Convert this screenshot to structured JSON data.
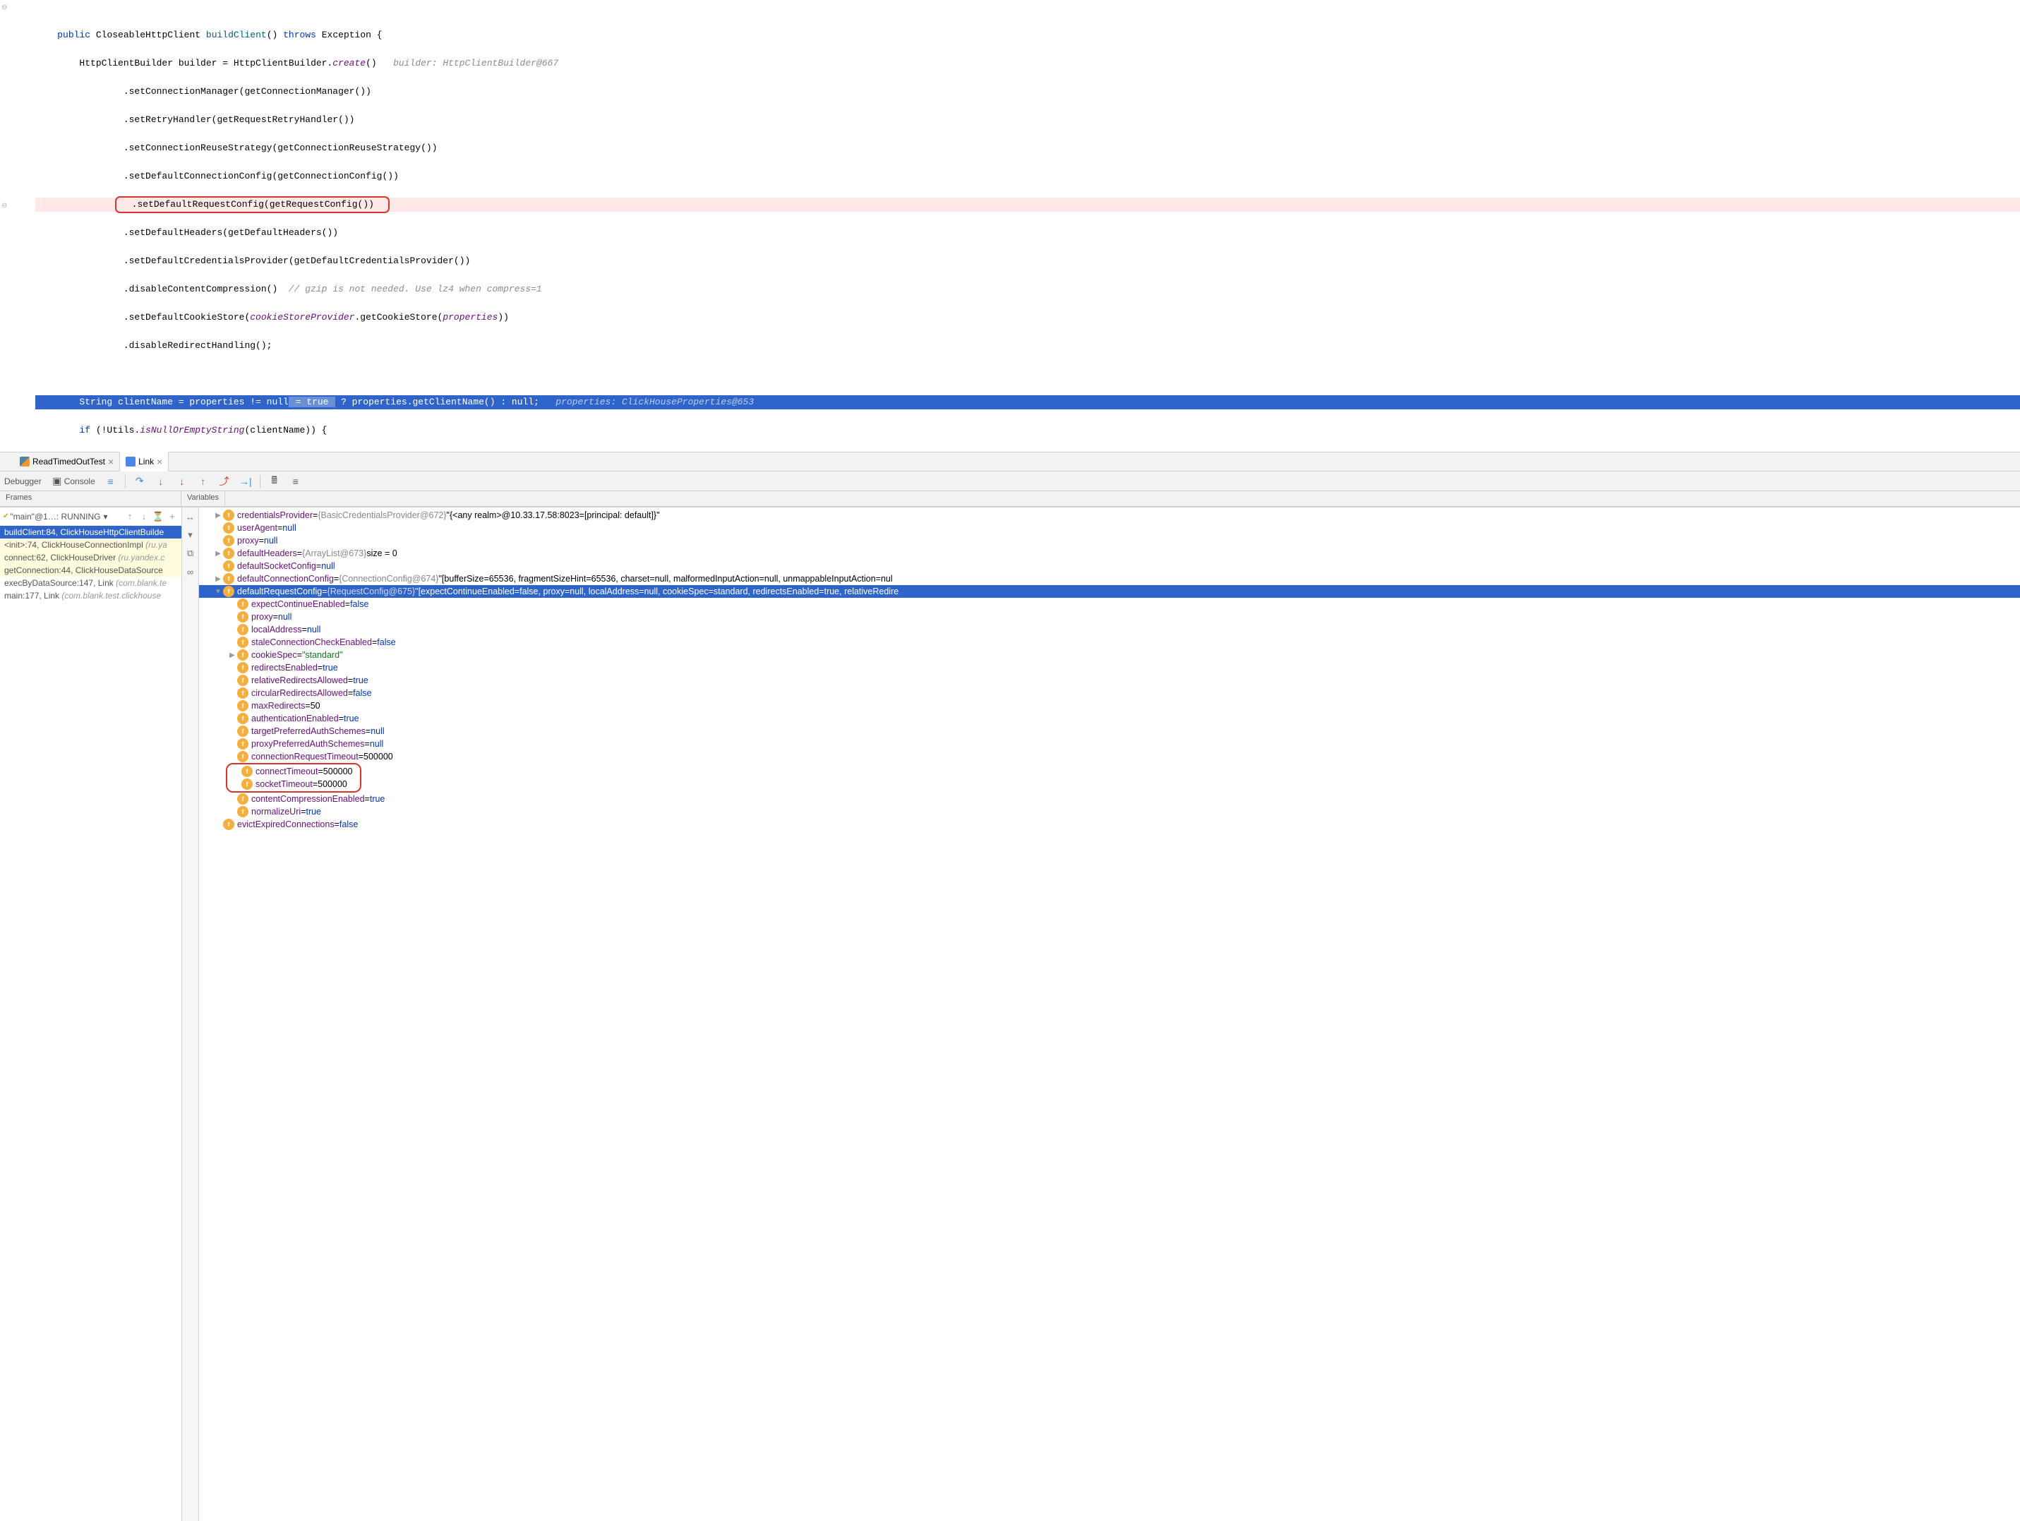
{
  "code": {
    "l1_public": "public",
    "l1_type": "CloseableHttpClient",
    "l1_method": "buildClient",
    "l1_throws": "throws",
    "l1_exc": "Exception {",
    "l2_a": "        HttpClientBuilder builder = HttpClientBuilder.",
    "l2_b": "create",
    "l2_c": "()",
    "l2_hint": "builder: HttpClientBuilder@667",
    "l3": "                .setConnectionManager(getConnectionManager())",
    "l4": "                .setRetryHandler(getRequestRetryHandler())",
    "l5": "                .setConnectionReuseStrategy(getConnectionReuseStrategy())",
    "l6": "                .setDefaultConnectionConfig(getConnectionConfig())",
    "l7": "                .setDefaultRequestConfig(getRequestConfig())",
    "l8": "                .setDefaultHeaders(getDefaultHeaders())",
    "l9": "                .setDefaultCredentialsProvider(getDefaultCredentialsProvider())",
    "l10_a": "                .disableContentCompression()  ",
    "l10_b": "// gzip is not needed. Use lz4 when compress=1",
    "l11_a": "                .setDefaultCookieStore(",
    "l11_b": "cookieStoreProvider",
    "l11_c": ".getCookieStore(",
    "l11_d": "properties",
    "l11_e": "))",
    "l12": "                .disableRedirectHandling();",
    "l13_a": "        String clientName = properties != null",
    "l13_bool": " = true ",
    "l13_b": " ? properties.getClientName() : null;   ",
    "l13_hint": "properties: ClickHouseProperties@653",
    "l14_a": "        if",
    "l14_b": " (!Utils.",
    "l14_c": "isNullOrEmptyString",
    "l14_d": "(clientName)) {"
  },
  "tabs": {
    "t1": "ReadTimedOutTest",
    "t2": "Link"
  },
  "toolbar": {
    "debugger": "Debugger",
    "console": "Console"
  },
  "headers": {
    "frames": "Frames",
    "variables": "Variables"
  },
  "thread": {
    "name": "\"main\"@1…: RUNNING"
  },
  "frames": {
    "f0_a": "buildClient:84, ClickHouseHttpClientBuilde",
    "f1_a": "<init>:74, ClickHouseConnectionImpl ",
    "f1_b": "(ru.ya",
    "f2_a": "connect:62, ClickHouseDriver ",
    "f2_b": "(ru.yandex.c",
    "f3_a": "getConnection:44, ClickHouseDataSource",
    "f4_a": "execByDataSource:147, Link ",
    "f4_b": "(com.blank.te",
    "f5_a": "main:177, Link ",
    "f5_b": "(com.blank.test.clickhouse"
  },
  "vars": {
    "v0_name": "credentialsProvider",
    "v0_obj": "{BasicCredentialsProvider@672}",
    "v0_val": "\"{<any realm>@10.33.17.58:8023=[principal: default]}\"",
    "v1_name": "userAgent",
    "v2_name": "proxy",
    "v3_name": "defaultHeaders",
    "v3_obj": "{ArrayList@673}",
    "v3_val": " size = 0",
    "v4_name": "defaultSocketConfig",
    "v5_name": "defaultConnectionConfig",
    "v5_obj": "{ConnectionConfig@674}",
    "v5_val": "\"[bufferSize=65536, fragmentSizeHint=65536, charset=null, malformedInputAction=null, unmappableInputAction=nul",
    "v6_name": "defaultRequestConfig",
    "v6_obj": "{RequestConfig@675}",
    "v6_val": "\"[expectContinueEnabled=false, proxy=null, localAddress=null, cookieSpec=standard, redirectsEnabled=true, relativeRedire",
    "c0_name": "expectContinueEnabled",
    "c0_val": "false",
    "c1_name": "proxy",
    "c2_name": "localAddress",
    "c3_name": "staleConnectionCheckEnabled",
    "c3_val": "false",
    "c4_name": "cookieSpec",
    "c4_val": "\"standard\"",
    "c5_name": "redirectsEnabled",
    "c5_val": "true",
    "c6_name": "relativeRedirectsAllowed",
    "c6_val": "true",
    "c7_name": "circularRedirectsAllowed",
    "c7_val": "false",
    "c8_name": "maxRedirects",
    "c8_val": "50",
    "c9_name": "authenticationEnabled",
    "c9_val": "true",
    "c10_name": "targetPreferredAuthSchemes",
    "c11_name": "proxyPreferredAuthSchemes",
    "c12_name": "connectionRequestTimeout",
    "c12_val": "500000",
    "c13_name": "connectTimeout",
    "c13_val": "500000",
    "c14_name": "socketTimeout",
    "c14_val": "500000",
    "c15_name": "contentCompressionEnabled",
    "c15_val": "true",
    "c16_name": "normalizeUri",
    "c16_val": "true",
    "v7_name": "evictExpiredConnections",
    "v7_val": "false",
    "null_lit": "null"
  }
}
